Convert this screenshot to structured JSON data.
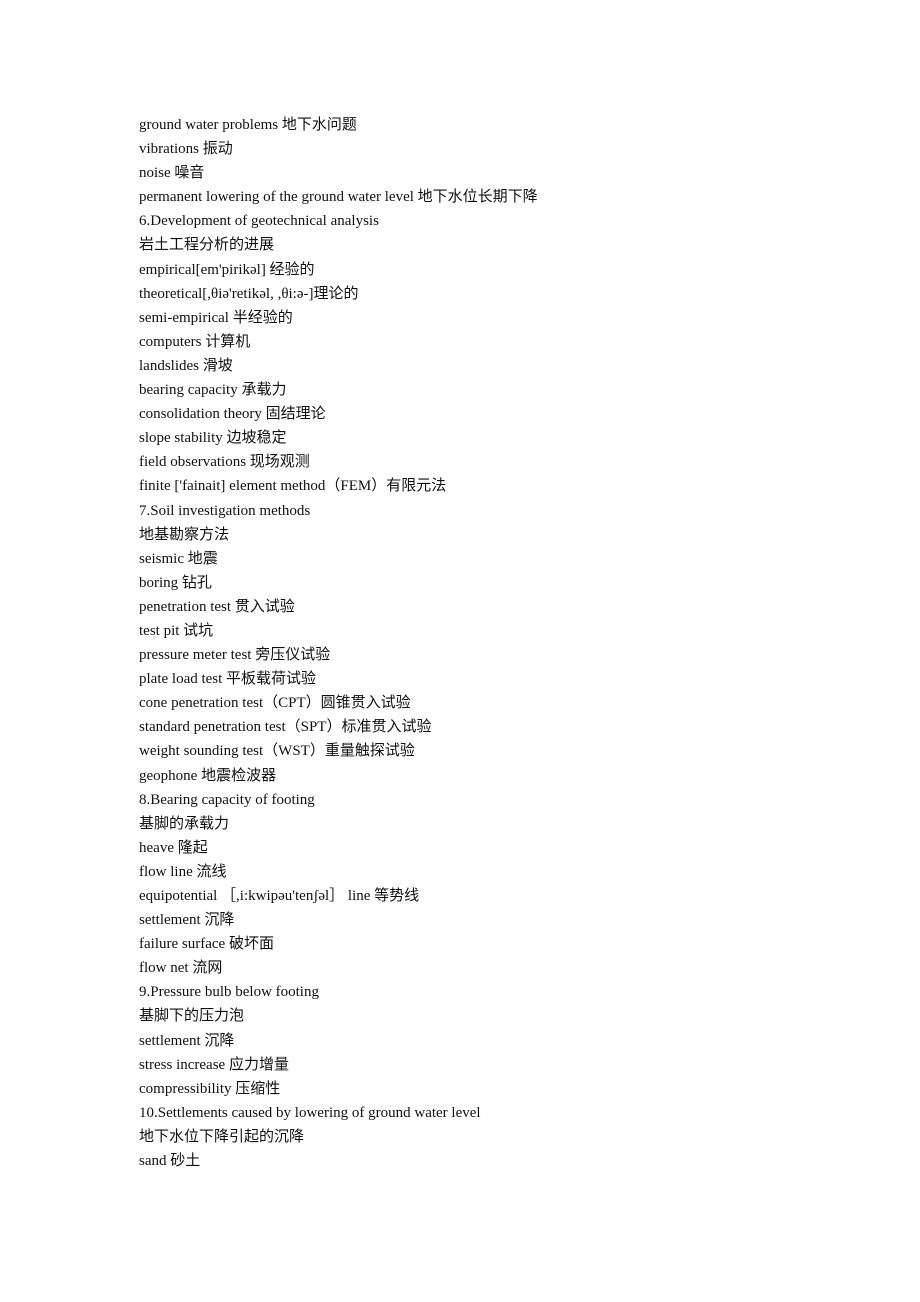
{
  "document": {
    "lines": [
      "ground water problems 地下水问题",
      "vibrations 振动",
      "noise 噪音",
      "permanent lowering of the ground water level 地下水位长期下降",
      "6.Development of geotechnical analysis",
      "岩土工程分析的进展",
      "empirical[em'pirikəl]  经验的",
      "theoretical[,θiə'retikəl, ,θi:ə-]理论的",
      "semi-empirical 半经验的",
      "computers 计算机",
      "landslides 滑坡",
      "bearing capacity 承载力",
      "consolidation theory 固结理论",
      "slope stability 边坡稳定",
      "field observations 现场观测",
      "finite ['fainait] element method（FEM）有限元法",
      "7.Soil investigation methods",
      "地基勘察方法",
      "seismic 地震",
      "boring 钻孔",
      "penetration test 贯入试验",
      "test pit 试坑",
      "pressure meter test 旁压仪试验",
      "plate load test 平板载荷试验",
      "cone penetration test（CPT）圆锥贯入试验",
      "standard penetration test（SPT）标准贯入试验",
      "weight sounding test（WST）重量触探试验",
      "geophone 地震检波器",
      "8.Bearing capacity of footing",
      "基脚的承载力",
      "heave 隆起",
      "flow line 流线",
      "equipotential ［,i:kwipəu'tenʃəl］ line 等势线",
      "settlement 沉降",
      "failure surface 破坏面",
      "flow net 流网",
      "9.Pressure bulb below footing",
      "基脚下的压力泡",
      "settlement 沉降",
      "stress increase 应力增量",
      "compressibility 压缩性",
      "10.Settlements caused by lowering of ground water level",
      "地下水位下降引起的沉降",
      "sand 砂土"
    ]
  }
}
